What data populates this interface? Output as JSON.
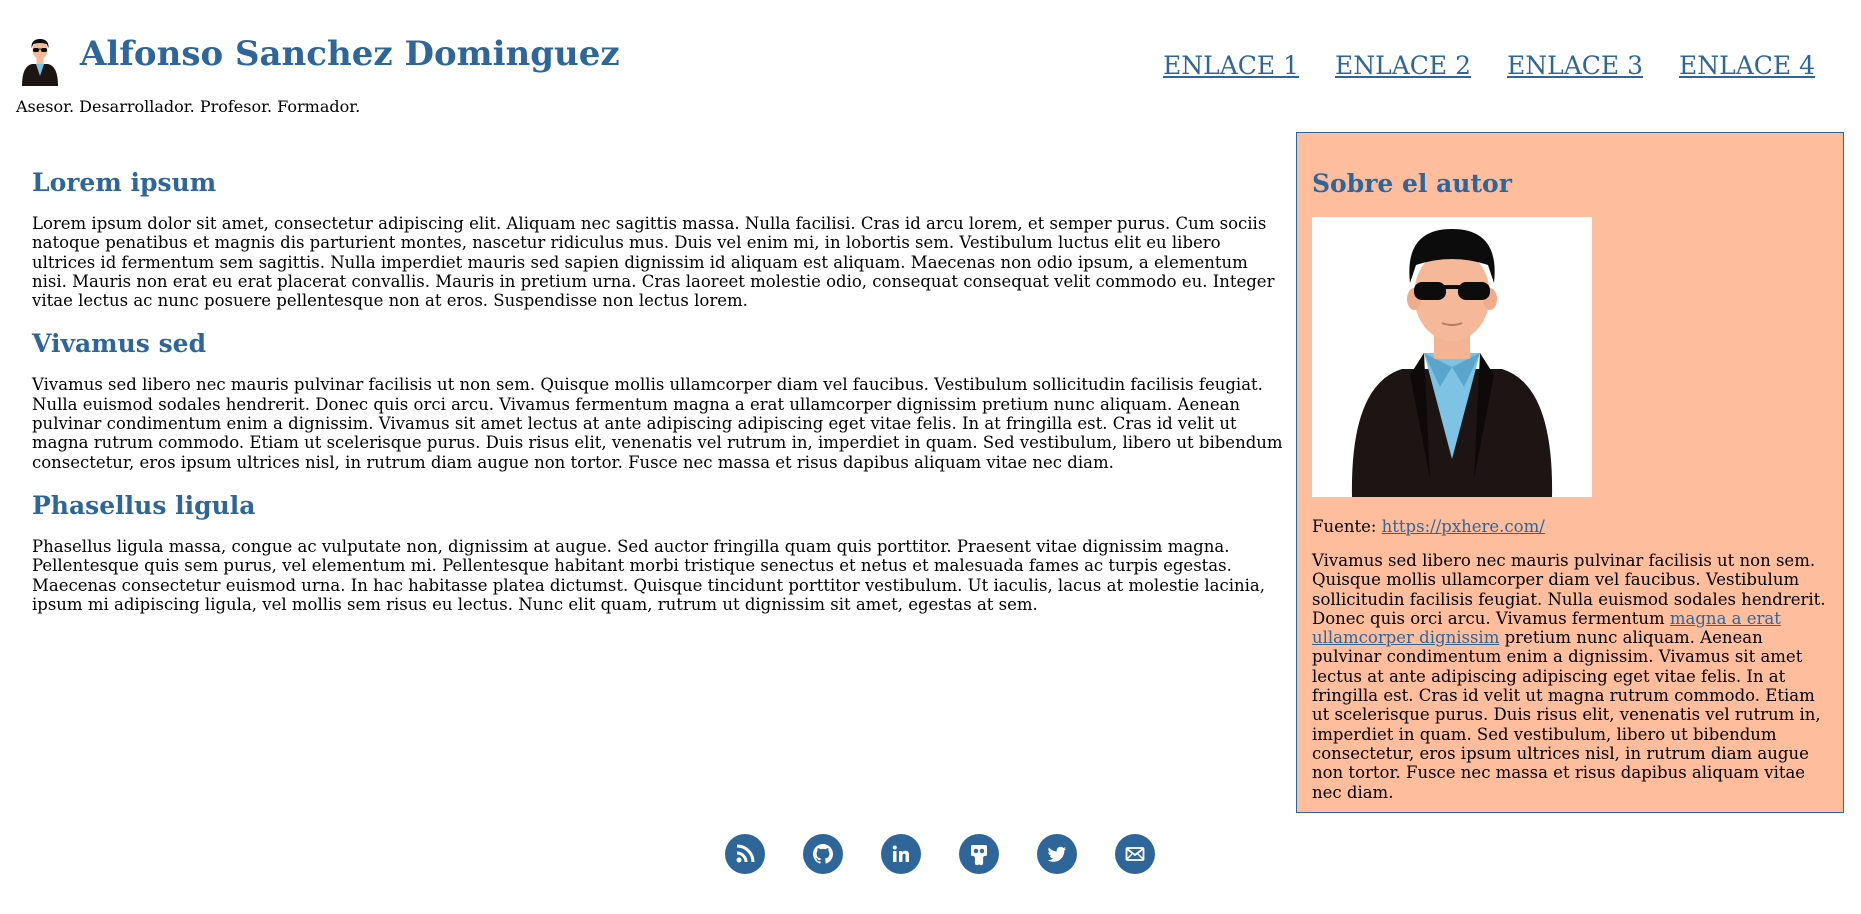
{
  "header": {
    "title": "Alfonso Sanchez Dominguez",
    "tagline": "Asesor. Desarrollador. Profesor. Formador.",
    "nav": [
      "ENLACE 1",
      "ENLACE 2",
      "ENLACE 3",
      "ENLACE 4"
    ]
  },
  "main": {
    "sections": [
      {
        "heading": "Lorem ipsum",
        "body": "Lorem ipsum dolor sit amet, consectetur adipiscing elit. Aliquam nec sagittis massa. Nulla facilisi. Cras id arcu lorem, et semper purus. Cum sociis natoque penatibus et magnis dis parturient montes, nascetur ridiculus mus. Duis vel enim mi, in lobortis sem. Vestibulum luctus elit eu libero ultrices id fermentum sem sagittis. Nulla imperdiet mauris sed sapien dignissim id aliquam est aliquam. Maecenas non odio ipsum, a elementum nisi. Mauris non erat eu erat placerat convallis. Mauris in pretium urna. Cras laoreet molestie odio, consequat consequat velit commodo eu. Integer vitae lectus ac nunc posuere pellentesque non at eros. Suspendisse non lectus lorem."
      },
      {
        "heading": "Vivamus sed",
        "body": "Vivamus sed libero nec mauris pulvinar facilisis ut non sem. Quisque mollis ullamcorper diam vel faucibus. Vestibulum sollicitudin facilisis feugiat. Nulla euismod sodales hendrerit. Donec quis orci arcu. Vivamus fermentum magna a erat ullamcorper dignissim pretium nunc aliquam. Aenean pulvinar condimentum enim a dignissim. Vivamus sit amet lectus at ante adipiscing adipiscing eget vitae felis. In at fringilla est. Cras id velit ut magna rutrum commodo. Etiam ut scelerisque purus. Duis risus elit, venenatis vel rutrum in, imperdiet in quam. Sed vestibulum, libero ut bibendum consectetur, eros ipsum ultrices nisl, in rutrum diam augue non tortor. Fusce nec massa et risus dapibus aliquam vitae nec diam."
      },
      {
        "heading": "Phasellus ligula",
        "body": "Phasellus ligula massa, congue ac vulputate non, dignissim at augue. Sed auctor fringilla quam quis porttitor. Praesent vitae dignissim magna. Pellentesque quis sem purus, vel elementum mi. Pellentesque habitant morbi tristique senectus et netus et malesuada fames ac turpis egestas. Maecenas consectetur euismod urna. In hac habitasse platea dictumst. Quisque tincidunt porttitor vestibulum. Ut iaculis, lacus at molestie lacinia, ipsum mi adipiscing ligula, vel mollis sem risus eu lectus. Nunc elit quam, rutrum ut dignissim sit amet, egestas at sem."
      }
    ]
  },
  "aside": {
    "heading": "Sobre el autor",
    "source_label": "Fuente:",
    "source_link": "https://pxhere.com/",
    "bio_before": "Vivamus sed libero nec mauris pulvinar facilisis ut non sem. Quisque mollis ullamcorper diam vel faucibus. Vestibulum sollicitudin facilisis feugiat. Nulla euismod sodales hendrerit. Donec quis orci arcu. Vivamus fermentum ",
    "bio_link": "magna a erat ullamcorper dignissim",
    "bio_after": " pretium nunc aliquam. Aenean pulvinar condimentum enim a dignissim. Vivamus sit amet lectus at ante adipiscing adipiscing eget vitae felis. In at fringilla est. Cras id velit ut magna rutrum commodo. Etiam ut scelerisque purus. Duis risus elit, venenatis vel rutrum in, imperdiet in quam. Sed vestibulum, libero ut bibendum consectetur, eros ipsum ultrices nisl, in rutrum diam augue non tortor. Fusce nec massa et risus dapibus aliquam vitae nec diam."
  },
  "footer": {
    "icons": [
      "rss-icon",
      "github-icon",
      "linkedin-icon",
      "slideshare-icon",
      "twitter-icon",
      "email-icon"
    ]
  },
  "colors": {
    "accent": "#2e6699",
    "aside_background": "#febd9d"
  }
}
